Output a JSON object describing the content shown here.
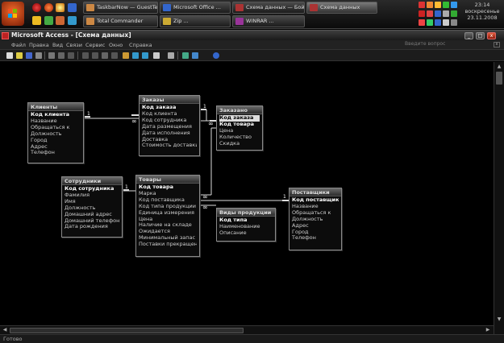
{
  "taskbar": {
    "tasks": [
      {
        "label": "TaskbarNow — GuestText...",
        "active": false
      },
      {
        "label": "Microsoft Office ...",
        "active": false
      },
      {
        "label": "Схема данных — Бойз...",
        "active": false
      },
      {
        "label": "Схема данных",
        "active": true
      },
      {
        "label": "Total Commander",
        "active": false
      },
      {
        "label": "Zip ...",
        "active": false
      },
      {
        "label": "WINRAR ...",
        "active": false
      }
    ],
    "clock": {
      "time": "23:14",
      "day": "воскресенье",
      "date": "23.11.2008"
    }
  },
  "window": {
    "title": "Microsoft Access - [Схема данных]",
    "minimize": "_",
    "maximize": "□",
    "close": "x"
  },
  "menu": {
    "items": [
      "Файл",
      "Правка",
      "Вид",
      "Связи",
      "Сервис",
      "Окно",
      "Справка"
    ],
    "help_placeholder": "Введите вопрос",
    "mdi_close": "x"
  },
  "status": {
    "text": "Готово"
  },
  "tables": [
    {
      "id": "clients",
      "title": "Клиенты",
      "fields": [
        "Код клиента",
        "Название",
        "Обращаться к",
        "Должность",
        "Город",
        "Адрес",
        "Телефон"
      ],
      "pk": [
        0
      ]
    },
    {
      "id": "orders",
      "title": "Заказы",
      "fields": [
        "Код заказа",
        "Код клиента",
        "Код сотрудника",
        "Дата размещения",
        "Дата исполнения",
        "Доставка",
        "Стоимость доставки"
      ],
      "pk": [
        0
      ]
    },
    {
      "id": "orderline",
      "title": "Заказано",
      "fields": [
        "Код заказа",
        "Код товара",
        "Цена",
        "Количество",
        "Скидка"
      ],
      "pk": [
        0,
        1
      ],
      "selected": 0
    },
    {
      "id": "employees",
      "title": "Сотрудники",
      "fields": [
        "Код сотрудника",
        "Фамилия",
        "Имя",
        "Должность",
        "Домашний адрес",
        "Домашний телефон",
        "Дата рождения"
      ],
      "pk": [
        0
      ]
    },
    {
      "id": "goods",
      "title": "Товары",
      "fields": [
        "Код товара",
        "Марка",
        "Код поставщика",
        "Код типа продукции",
        "Единица измерения",
        "Цена",
        "Наличие на складе",
        "Ожидается",
        "Минимальный запас",
        "Поставки прекращены"
      ],
      "pk": [
        0
      ]
    },
    {
      "id": "types",
      "title": "Виды продукции",
      "fields": [
        "Код типа",
        "Наименование",
        "Описание"
      ],
      "pk": [
        0
      ]
    },
    {
      "id": "suppliers",
      "title": "Поставщики",
      "fields": [
        "Код поставщика",
        "Название",
        "Обращаться к",
        "Должность",
        "Адрес",
        "Город",
        "Телефон"
      ],
      "pk": [
        0
      ]
    }
  ],
  "relations": [
    {
      "from": "clients",
      "to": "orders",
      "one": "1",
      "many": "∞"
    },
    {
      "from": "orders",
      "to": "orderline",
      "one": "1",
      "many": "∞"
    },
    {
      "from": "employees",
      "to": "goods",
      "one": "1",
      "many": "∞"
    },
    {
      "from": "goods",
      "to": "orderline",
      "one": "1",
      "many": "∞"
    },
    {
      "from": "goods",
      "to": "types",
      "one": "1",
      "many": "∞"
    },
    {
      "from": "goods",
      "to": "suppliers",
      "one": "1",
      "many": "∞"
    }
  ],
  "colors": {
    "accent": "#d9452a",
    "canvas": "#000000",
    "table_header": "#4a4a4a"
  }
}
